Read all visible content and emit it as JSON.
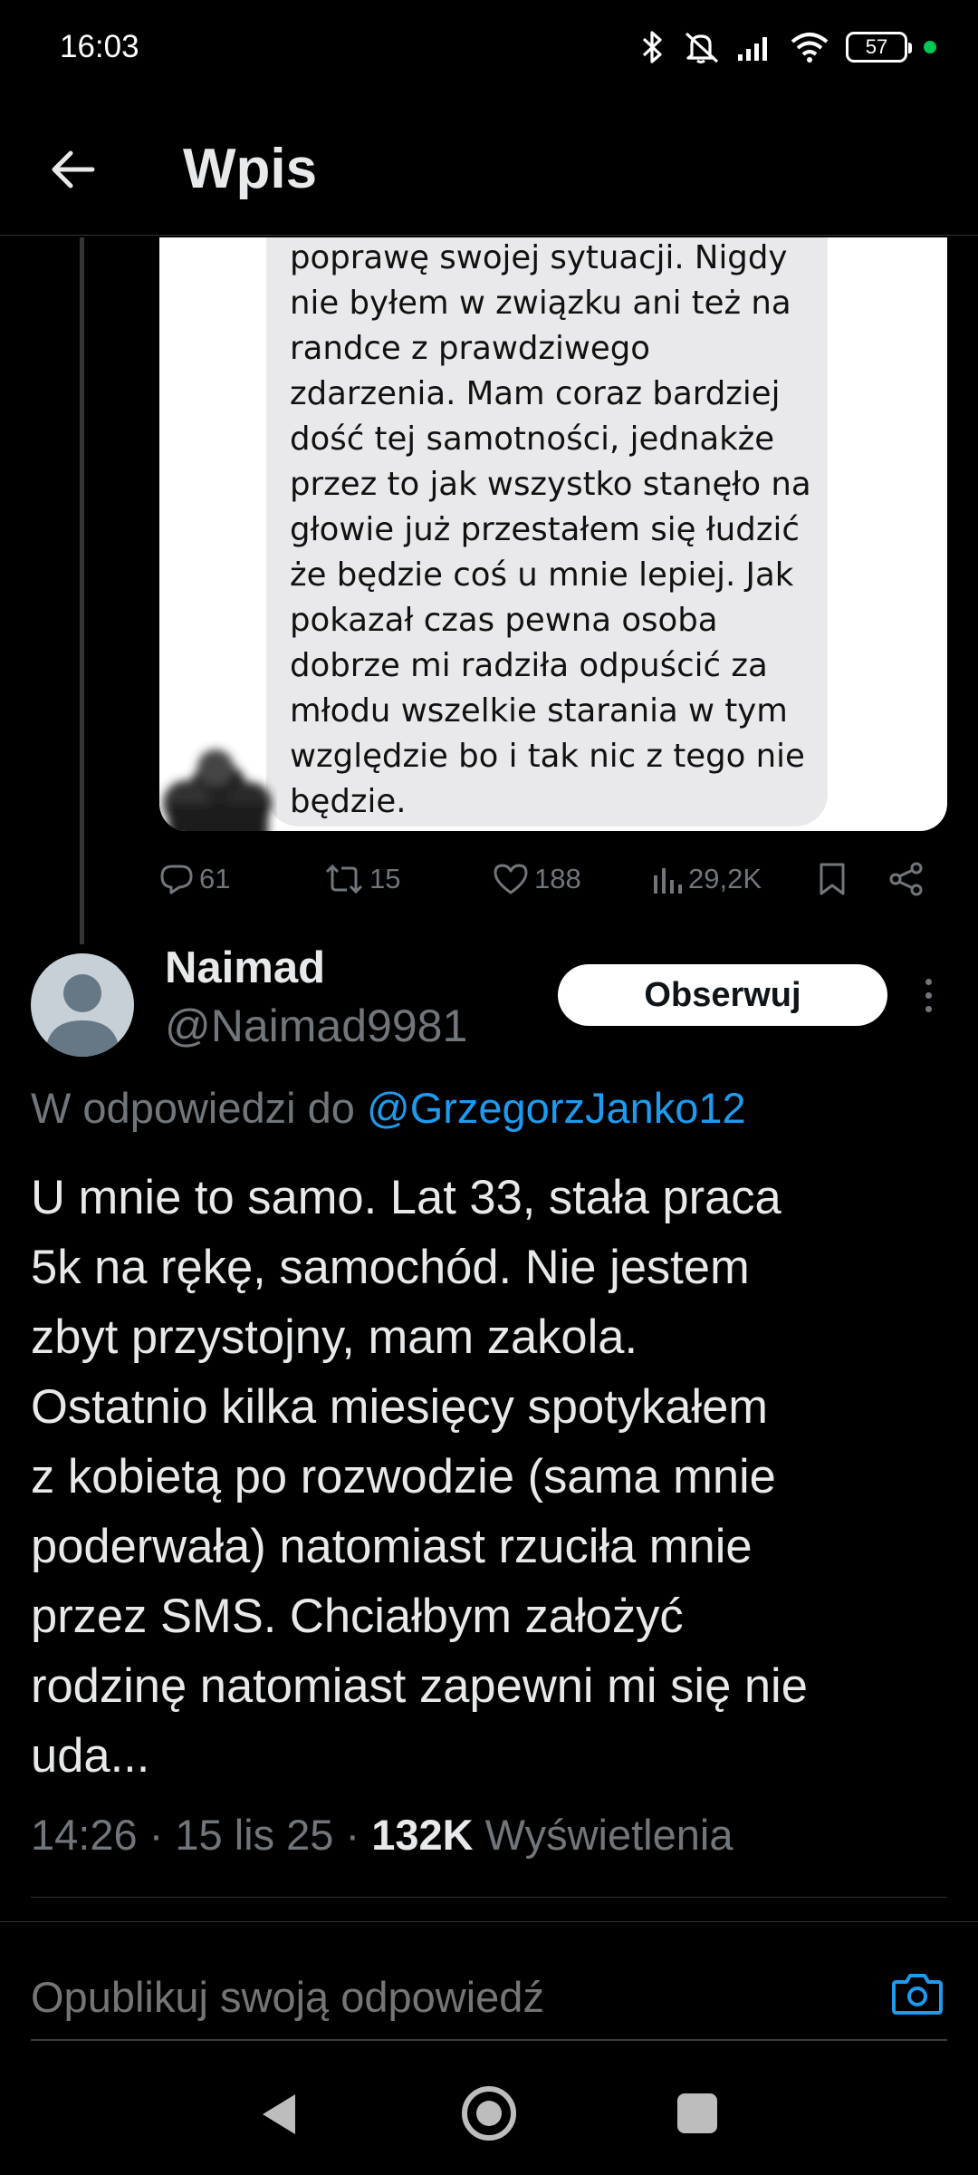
{
  "status_bar": {
    "time": "16:03",
    "battery": "57",
    "icons": [
      "bluetooth-icon",
      "mute-icon",
      "signal-icon",
      "wifi-icon",
      "battery-icon",
      "dot-icon"
    ]
  },
  "header": {
    "title": "Wpis",
    "back_icon": "arrow-left-icon"
  },
  "quoted_image": {
    "message_lines": [
      "poprawę swojej sytuacji. Nigdy",
      "nie byłem w związku ani też na",
      "randce z prawdziwego",
      "zdarzenia. Mam coraz bardziej",
      "dość tej samotności, jednakże",
      "przez to jak wszystko stanęło na",
      "głowie już przestałem się łudzić",
      "że będzie coś u mnie lepiej. Jak",
      "pokazał czas pewna osoba",
      "dobrze mi radziła odpuścić za",
      "młodu wszelkie starania w tym",
      "względzie bo i tak nic z tego nie",
      "będzie."
    ],
    "bubble_color": "#e9e9eb"
  },
  "parent_actions": {
    "replies": "61",
    "reposts": "15",
    "likes": "188",
    "views": "29,2K"
  },
  "tweet": {
    "display_name": "Naimad",
    "handle": "@Naimad9981",
    "follow_label": "Obserwuj",
    "reply_prefix": "W odpowiedzi do ",
    "reply_mention": "@GrzegorzJanko12",
    "text_lines": [
      "U mnie to samo. Lat 33, stała praca",
      "5k na rękę, samochód. Nie jestem",
      "zbyt przystojny, mam zakola.",
      "Ostatnio kilka miesięcy spotykałem",
      "z kobietą po rozwodzie (sama mnie",
      "poderwała) natomiast rzuciła mnie",
      "przez SMS. Chciałbym założyć",
      "rodzinę natomiast zapewni mi się nie",
      "uda..."
    ],
    "meta_time_date": "14:26 · 15 lis 25 · ",
    "meta_views": "132K",
    "meta_views_label": " Wyświetlenia"
  },
  "reply_box": {
    "placeholder": "Opublikuj swoją odpowiedź"
  },
  "colors": {
    "background": "#000000",
    "accent": "#1d9bf0",
    "muted": "#71767b",
    "text": "#e7e9ea"
  }
}
